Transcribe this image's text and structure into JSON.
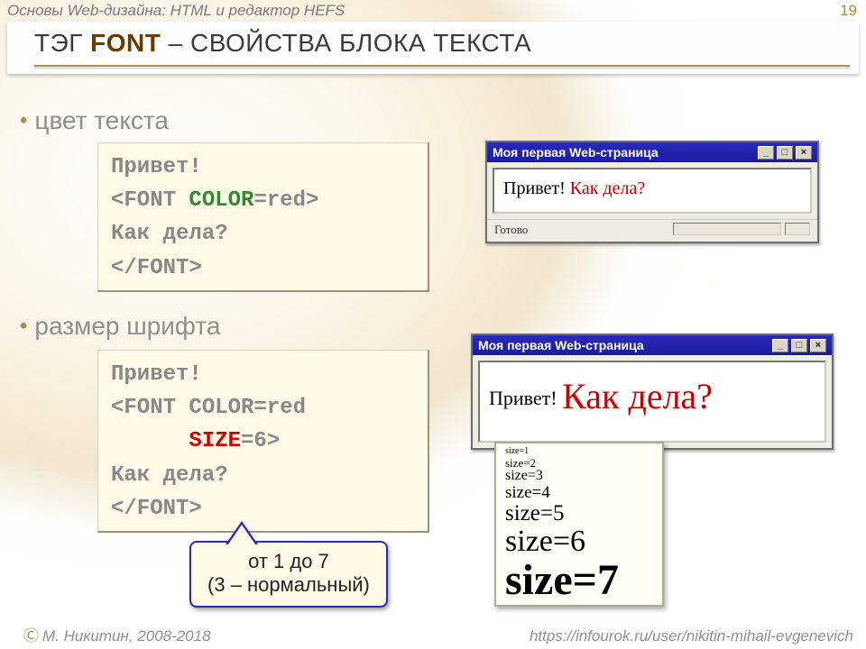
{
  "header": {
    "breadcrumb": "Основы Web-дизайна: HTML и редактор HEFS"
  },
  "page_number": "19",
  "title": {
    "pre": "ТЭГ ",
    "tag": "FONT",
    "post": " – СВОЙСТВА БЛОКА ТЕКСТА"
  },
  "bullets": {
    "color": "цвет текста",
    "size": "размер шрифта"
  },
  "code1": {
    "l1": "Привет!",
    "l2a": "<FONT ",
    "l2b": "COLOR",
    "l2c": "=red>",
    "l3": "Как дела?",
    "l4": "</FONT>"
  },
  "code2": {
    "l1": "Привет!",
    "l2": "<FONT COLOR=red",
    "l3a": "      ",
    "l3b": "SIZE",
    "l3c": "=6>",
    "l4": "Как дела?",
    "l5": "</FONT>"
  },
  "mini1": {
    "title": "Моя первая Web-страница",
    "text_black": "Привет! ",
    "text_red": "Как дела?",
    "status": "Готово"
  },
  "mini2": {
    "title": "Моя первая Web-страница",
    "text_black": "Привет! ",
    "text_red": "Как дела?"
  },
  "sizes": {
    "s1": "size=1",
    "s2": "size=2",
    "s3": "size=3",
    "s4": "size=4",
    "s5": "size=5",
    "s6": "size=6",
    "s7": "size=7"
  },
  "callout": {
    "line1": "от 1 до 7",
    "line2": "(3 – нормальный)"
  },
  "footer": {
    "author": "М. Никитин, 2008-2018",
    "url": "https://infourok.ru/user/nikitin-mihail-evgenevich"
  },
  "ctrls": {
    "min": "_",
    "max": "□",
    "close": "×"
  }
}
